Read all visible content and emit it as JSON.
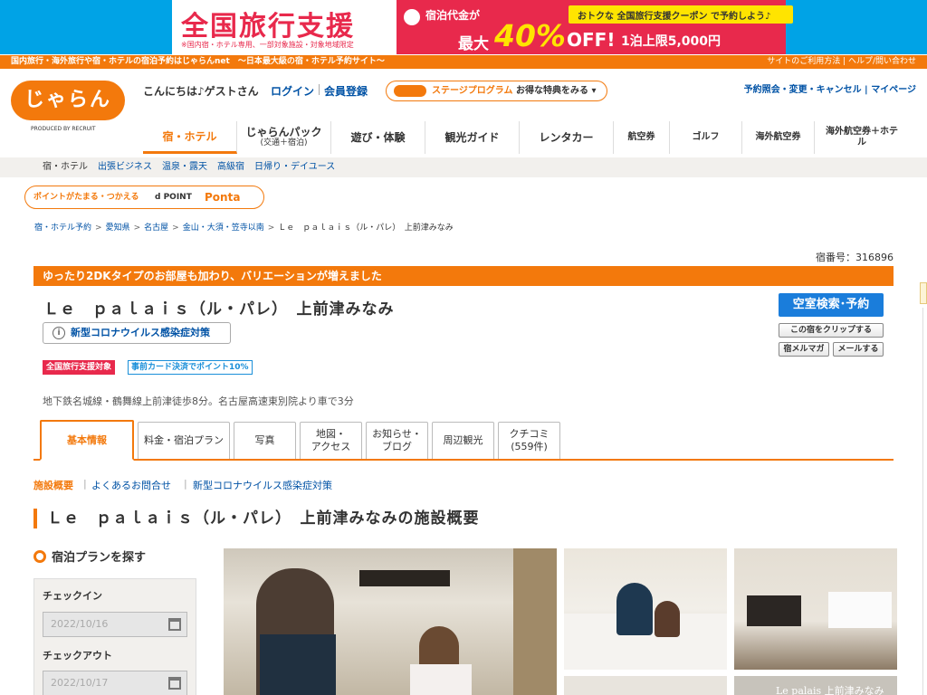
{
  "banner": {
    "title": "全国旅行支援",
    "note": "※国内宿・ホテル専用、一部対象施設・対象地域限定",
    "sub": "宿泊代金が",
    "coupon": "おトクな 全国旅行支援クーポン で予約しよう♪",
    "max": "最大",
    "percent": "40%",
    "off": "OFF!",
    "limit": "1泊上限5,000円"
  },
  "orange_bar": {
    "left": "国内旅行・海外旅行や宿・ホテルの宿泊予約はじゃらんnet　〜日本最大級の宿・ホテル予約サイト〜",
    "right": "サイトのご利用方法 | ヘルプ/問い合わせ"
  },
  "header": {
    "logo": "じゃらん",
    "logo_sub": "PRODUCED BY RECRUIT",
    "greeting": "こんにちは♪ゲストさん",
    "login": "ログイン",
    "register": "会員登録",
    "stage_title": "ステージプログラム",
    "stage_cta": "お得な特典をみる ▾",
    "links": "予約照会・変更・キャンセル | マイページ"
  },
  "gnav": {
    "hotel": "宿・ホテル",
    "pack": "じゃらんパック",
    "pack_sub": "(交通＋宿泊)",
    "play": "遊び・体験",
    "guide": "観光ガイド",
    "rental": "レンタカー",
    "air": "航空券",
    "golf": "ゴルフ",
    "overseas": "海外航空券",
    "overseas_hotel": "海外航空券＋ホテル"
  },
  "subnav": {
    "current": "宿・ホテル",
    "business": "出張ビジネス",
    "onsen": "温泉・露天",
    "luxury": "高級宿",
    "daytrip": "日帰り・デイユース"
  },
  "ponta": {
    "text": "ポイントがたまる・つかえる",
    "dpoint": "d POINT",
    "ponta": "Ponta"
  },
  "breadcrumb": {
    "b1": "宿・ホテル予約",
    "b2": "愛知県",
    "b3": "名古屋",
    "b4": "金山・大須・笠寺以南",
    "current": "Ｌｅ　ｐａｌａｉｓ（ル・パレ）　上前津みなみ"
  },
  "hotel": {
    "number": "宿番号：316896",
    "notice": "ゆったり2DKタイプのお部屋も加わり、バリエーションが増えました",
    "name": "Ｌｅ　ｐａｌａｉｓ（ル・パレ）　上前津みなみ",
    "covid": "新型コロナウイルス感染症対策",
    "badge_travel": "全国旅行支援対象",
    "badge_card": "事前カード決済でポイント10%",
    "access": "地下鉄名城線・鶴舞線上前津徒歩8分。名古屋高速東別院より車で3分",
    "search_btn": "空室検索･予約",
    "clip_btn": "この宿をクリップする",
    "mag_btn": "宿メルマガ",
    "mail_btn": "メールする"
  },
  "tabs": {
    "basic": "基本情報",
    "plans": "料金・宿泊プラン",
    "photos": "写真",
    "map1": "地図・",
    "map2": "アクセス",
    "news1": "お知らせ・",
    "news2": "ブログ",
    "sight": "周辺観光",
    "review1": "クチコミ",
    "review2": "(559件)"
  },
  "sublinks": {
    "overview": "施設概要",
    "faq": "よくあるお問合せ",
    "covid": "新型コロナウイルス感染症対策"
  },
  "section_title": "Ｌｅ　ｐａｌａｉｓ（ル・パレ）　上前津みなみの施設概要",
  "sidebar": {
    "title": "宿泊プランを探す",
    "checkin_label": "チェックイン",
    "checkin": "2022/10/16",
    "checkout_label": "チェックアウト",
    "checkout": "2022/10/17"
  },
  "photo_caption": "Le palais 上前津みなみ"
}
